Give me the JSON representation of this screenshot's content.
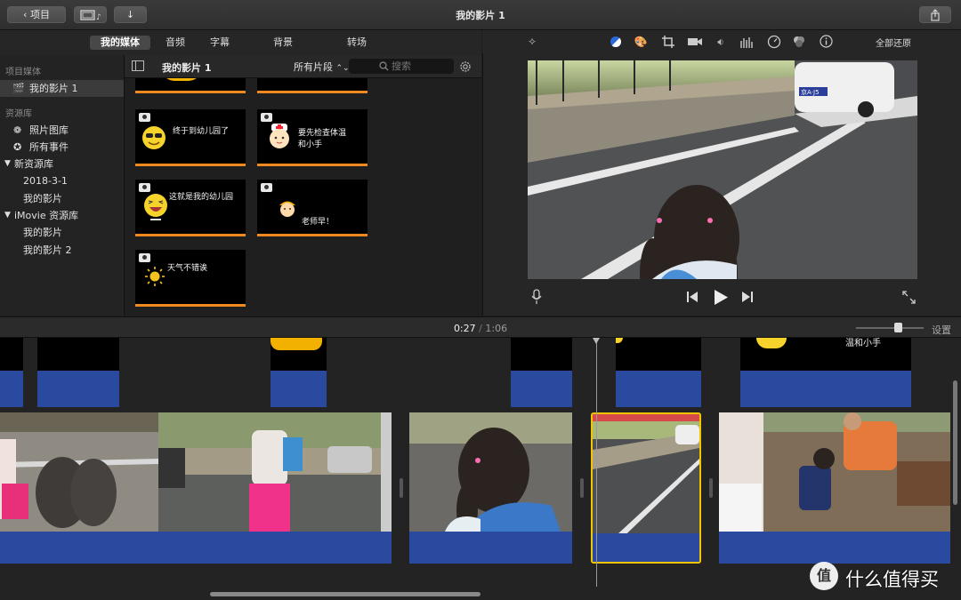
{
  "toolbar": {
    "back_label": "项目",
    "window_title": "我的影片 1"
  },
  "media_tabs": [
    "我的媒体",
    "音频",
    "字幕",
    "背景",
    "转场"
  ],
  "sidebar": {
    "project_media_header": "项目媒体",
    "project_item": "我的影片 1",
    "libraries_header": "资源库",
    "photos_library": "照片图库",
    "all_events": "所有事件",
    "new_library": "新资源库",
    "new_library_items": [
      "2018-3-1",
      "我的影片"
    ],
    "imovie_library": "iMovie 资源库",
    "imovie_library_items": [
      "我的影片",
      "我的影片 2"
    ]
  },
  "browser": {
    "title": "我的影片 1",
    "filter_label": "所有片段",
    "search_placeholder": "搜索",
    "clip_captions": [
      "终于到幼儿园了",
      "要先检查体温和小手",
      "这就是我的幼儿园",
      "老师早！",
      "天气不错诶"
    ]
  },
  "viewer": {
    "reset_all": "全部还原",
    "car_plate": "京A·J5"
  },
  "timeline": {
    "current_time": "0:27",
    "separator": "/",
    "total_time": "1:06",
    "settings_label": "设置",
    "zoom_level": 0.62,
    "title_fragments": [
      "温和小手"
    ]
  },
  "watermark": {
    "text": "什么值得买",
    "logo_char": "值"
  },
  "colors": {
    "accent_orange": "#f08a1e",
    "title_band_blue": "#2a4aa0",
    "selection_yellow": "#f2c500"
  }
}
